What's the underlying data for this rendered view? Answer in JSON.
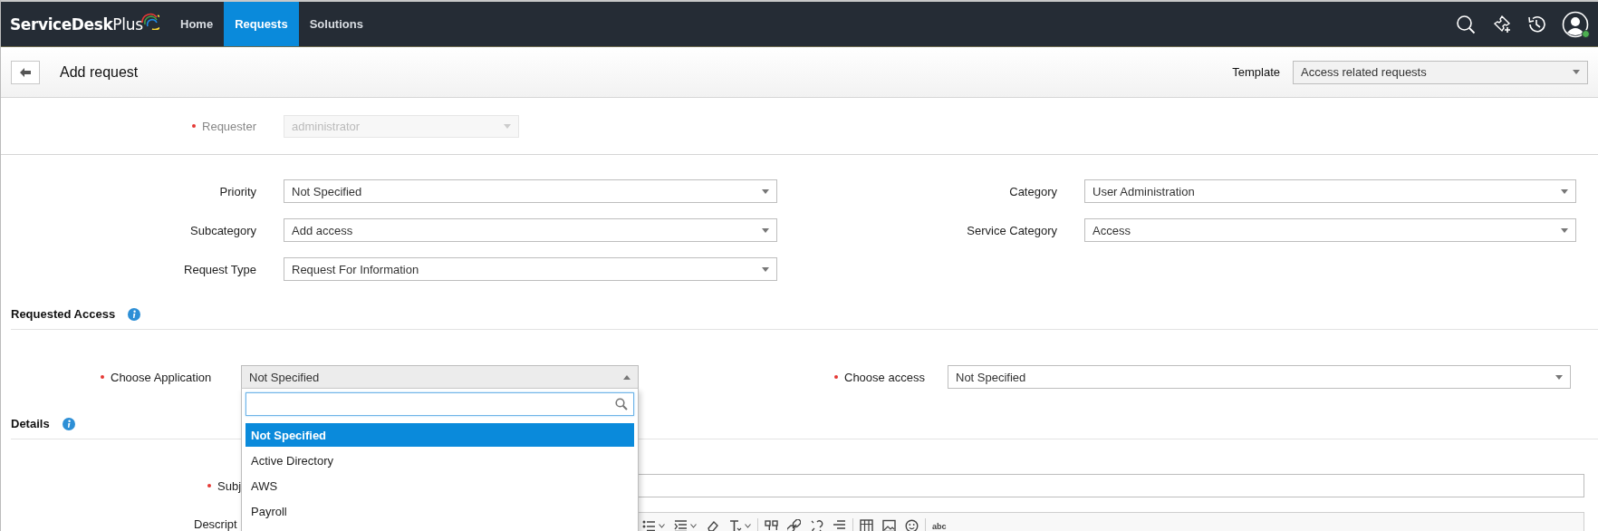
{
  "topbar": {
    "logo": {
      "name": "ServiceDesk",
      "suffix": "Plus"
    },
    "tabs": [
      {
        "label": "Home",
        "selected": false
      },
      {
        "label": "Requests",
        "selected": true
      },
      {
        "label": "Solutions",
        "selected": false
      }
    ],
    "user": {
      "online": true
    }
  },
  "header": {
    "title": "Add request",
    "template": {
      "label": "Template",
      "value": "Access related requests"
    }
  },
  "requester": {
    "label": "Requester",
    "required": true,
    "value": "administrator",
    "disabled": true
  },
  "fields": [
    {
      "label": "Priority",
      "value": "Not Specified"
    },
    {
      "label": "Category",
      "value": "User Administration"
    },
    {
      "label": "Subcategory",
      "value": "Add access"
    },
    {
      "label": "Service Category",
      "value": "Access"
    },
    {
      "label": "Request Type",
      "value": "Request For Information"
    }
  ],
  "requested_access": {
    "title": "Requested Access",
    "fields": [
      {
        "label": "Choose Application",
        "required": true,
        "value": "Not Specified",
        "expanded": true,
        "options": [
          {
            "label": "Not Specified",
            "selected": true
          },
          {
            "label": "Active Directory",
            "selected": false
          },
          {
            "label": "AWS",
            "selected": false
          },
          {
            "label": "Payroll",
            "selected": false
          }
        ]
      },
      {
        "label": "Choose access",
        "required": true,
        "value": "Not Specified",
        "expanded": false
      }
    ]
  },
  "details": {
    "title": "Details",
    "subject": {
      "label": "Subj",
      "required": true
    },
    "description": {
      "label": "Descript",
      "toolbar": [
        {
          "kind": "bullets",
          "caret": true
        },
        {
          "kind": "indent",
          "caret": true
        },
        {
          "kind": "eraser",
          "caret": false
        },
        {
          "kind": "clear-format",
          "caret": true
        },
        {
          "kind": "separator"
        },
        {
          "kind": "quote",
          "caret": false
        },
        {
          "kind": "link",
          "caret": false
        },
        {
          "kind": "unlink",
          "caret": false
        },
        {
          "kind": "align",
          "caret": false
        },
        {
          "kind": "separator"
        },
        {
          "kind": "table",
          "caret": false
        },
        {
          "kind": "image",
          "caret": false
        },
        {
          "kind": "emoji",
          "caret": false
        },
        {
          "kind": "separator"
        },
        {
          "kind": "spellcheck",
          "label": "abc"
        }
      ]
    }
  }
}
